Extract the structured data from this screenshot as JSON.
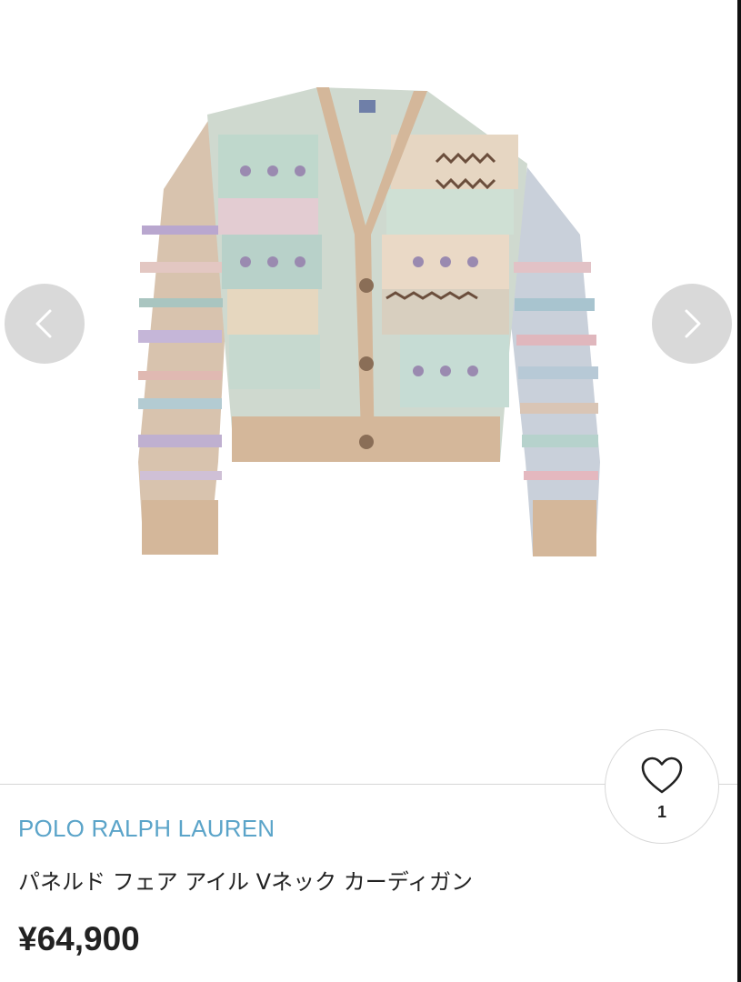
{
  "carousel": {
    "prev_icon": "chevron-left-icon",
    "next_icon": "chevron-right-icon",
    "image_alt": "Fair Isle patchwork V-neck cardigan",
    "colors": {
      "arrow_bg": "#d9d9d9",
      "arrow_glyph": "#ffffff"
    }
  },
  "like": {
    "icon": "heart-icon",
    "count": "1"
  },
  "product": {
    "brand": "POLO RALPH LAUREN",
    "title": "パネルド フェア アイル Vネック カーディガン",
    "price": "¥64,900"
  },
  "colors": {
    "brand": "#5ba4c9",
    "text": "#222222",
    "divider": "#d6d6d6"
  }
}
